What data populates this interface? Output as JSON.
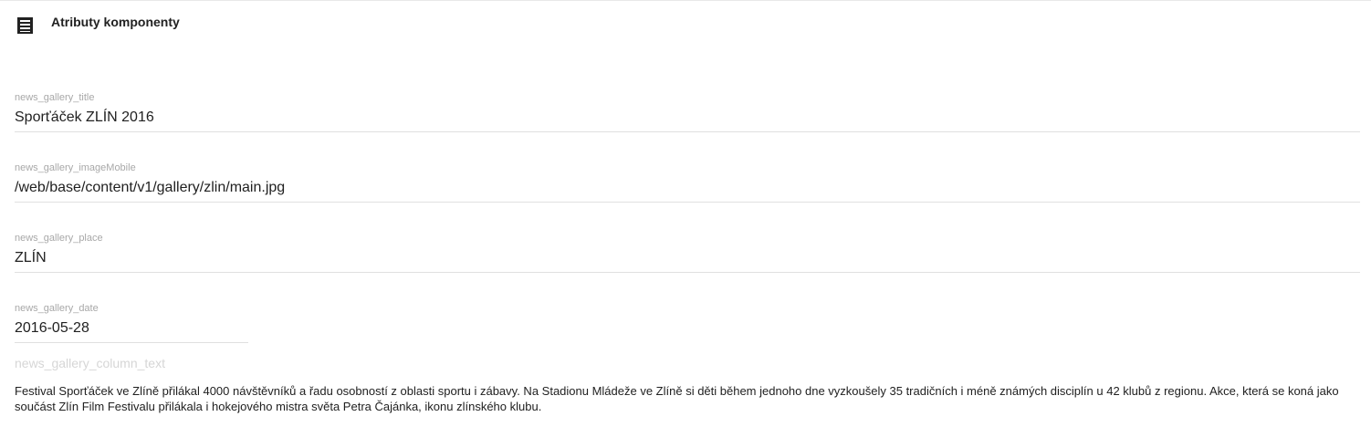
{
  "header": {
    "icon": "list-icon",
    "title": "Atributy komponenty"
  },
  "fields": [
    {
      "label": "news_gallery_title",
      "value": "Sporťáček ZLÍN 2016"
    },
    {
      "label": "news_gallery_imageMobile",
      "value": "/web/base/content/v1/gallery/zlin/main.jpg"
    },
    {
      "label": "news_gallery_place",
      "value": "ZLÍN"
    },
    {
      "label": "news_gallery_date",
      "value": "2016-05-28"
    }
  ],
  "column_text": {
    "label": "news_gallery_column_text",
    "value": "Festival Sporťáček ve Zlíně přilákal 4000 návštěvníků a řadu osobností z oblasti sportu i zábavy. Na Stadionu Mládeže ve Zlíně si děti během jednoho dne vyzkoušely 35 tradičních i méně známých disciplín u 42 klubů z regionu. Akce, která se koná jako součást Zlín Film Festivalu přilákala i hokejového mistra světa Petra Čajánka, ikonu zlínského klubu."
  }
}
